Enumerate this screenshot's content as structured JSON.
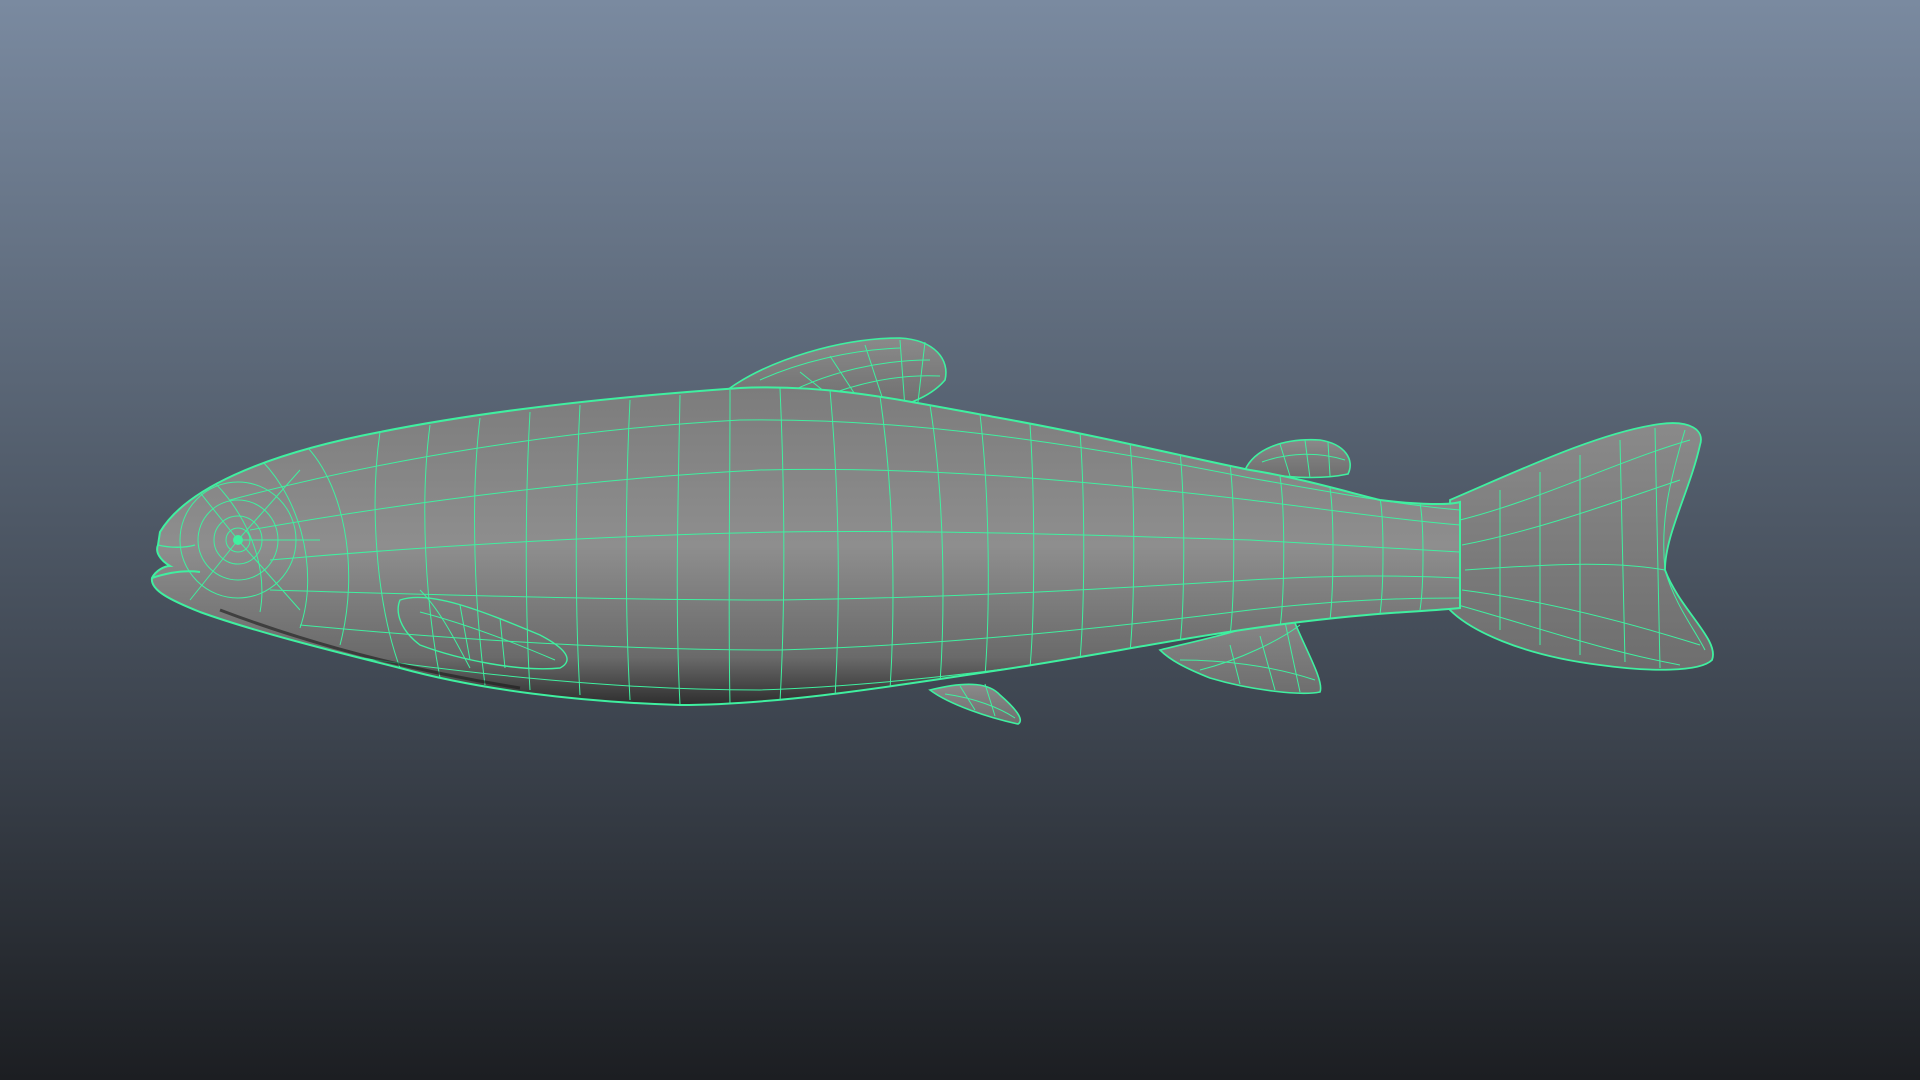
{
  "viewport": {
    "background_top": "#7a8aa0",
    "background_bottom": "#1c1e22"
  },
  "model": {
    "name": "fish-mesh",
    "shading": "wireframe-on-shaded",
    "wire_color": "#3ff0a0",
    "surface_color": "#8a8a8a"
  }
}
